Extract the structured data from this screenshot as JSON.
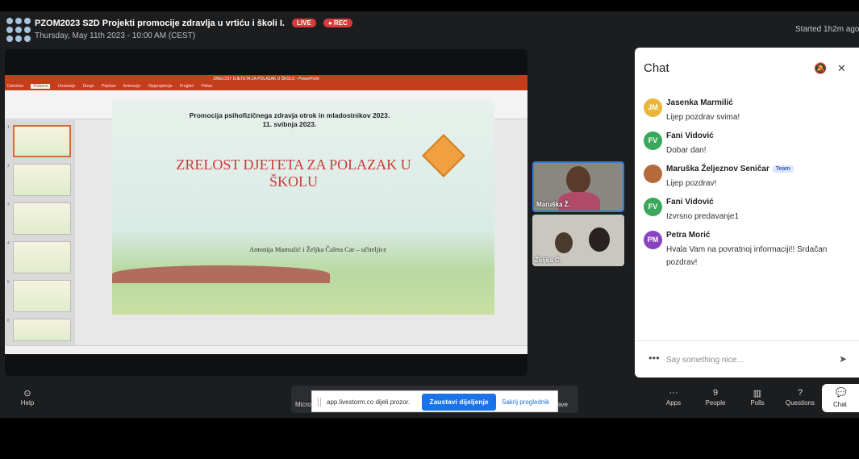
{
  "header": {
    "title": "PZOM2023 S2D Projekti promocije zdravlja u vrtiću i školi I.",
    "live_badge": "LIVE",
    "rec_badge": "● REC",
    "datetime": "Thursday, May 11th 2023 - 10:00 AM (CEST)",
    "started": "Started 1h2m ago"
  },
  "slide": {
    "header_line1": "Promocija psihofizičnega zdravja otrok in mladostnikov 2023.",
    "header_line2": "11. svibnja 2023.",
    "title": "ZRELOST DJETETA ZA POLAZAK U ŠKOLU",
    "authors": "Antonija Mamužić i Željka Čaleta Car – učiteljice"
  },
  "ppt": {
    "window_title": "ZRELOST DJETETA ZA POLAZAK U ŠKOLU - PowerPoint",
    "tabs": [
      "Datoteka",
      "Polazno",
      "Umetanje",
      "Dizajn",
      "Prijelazi",
      "Animacije",
      "Dijaprojekcija",
      "Pregled",
      "Prikaz"
    ]
  },
  "videos": [
    {
      "label": "Maruška Ž."
    },
    {
      "label": "Željka C."
    }
  ],
  "chat": {
    "title": "Chat",
    "messages": [
      {
        "initials": "JM",
        "name": "Jasenka Marmilić",
        "text": "Lijep pozdrav svima!",
        "color": "#e9b63a"
      },
      {
        "initials": "FV",
        "name": "Fani Vidović",
        "text": "Dobar dan!",
        "color": "#3aa85a"
      },
      {
        "initials": "",
        "name": "Maruška Željeznov Seničar",
        "team": "Team",
        "text": "Lijep pozdrav!",
        "color": "#b56a3c"
      },
      {
        "initials": "FV",
        "name": "Fani Vidović",
        "text": "Izvrsno predavanje1",
        "color": "#3aa85a"
      },
      {
        "initials": "PM",
        "name": "Petra Morić",
        "text": "Hvala Vam na povratnoj informaciji!! Srdačan pozdrav!",
        "color": "#8a43c0"
      }
    ],
    "input_placeholder": "Say something nice...",
    "more_icon": "more-dots-icon",
    "send_icon": "send-icon"
  },
  "toolbar": {
    "help": "Help",
    "micro": "Micro",
    "leave": "ave",
    "apps": "Apps",
    "people_count": "9",
    "people": "People",
    "polls": "Polls",
    "questions": "Questions",
    "chat": "Chat"
  },
  "share_popup": {
    "text": "app.livestorm.co dijeli prozor.",
    "stop_button": "Zaustavi dijeljenje",
    "hide_link": "Sakrij preglednik"
  }
}
